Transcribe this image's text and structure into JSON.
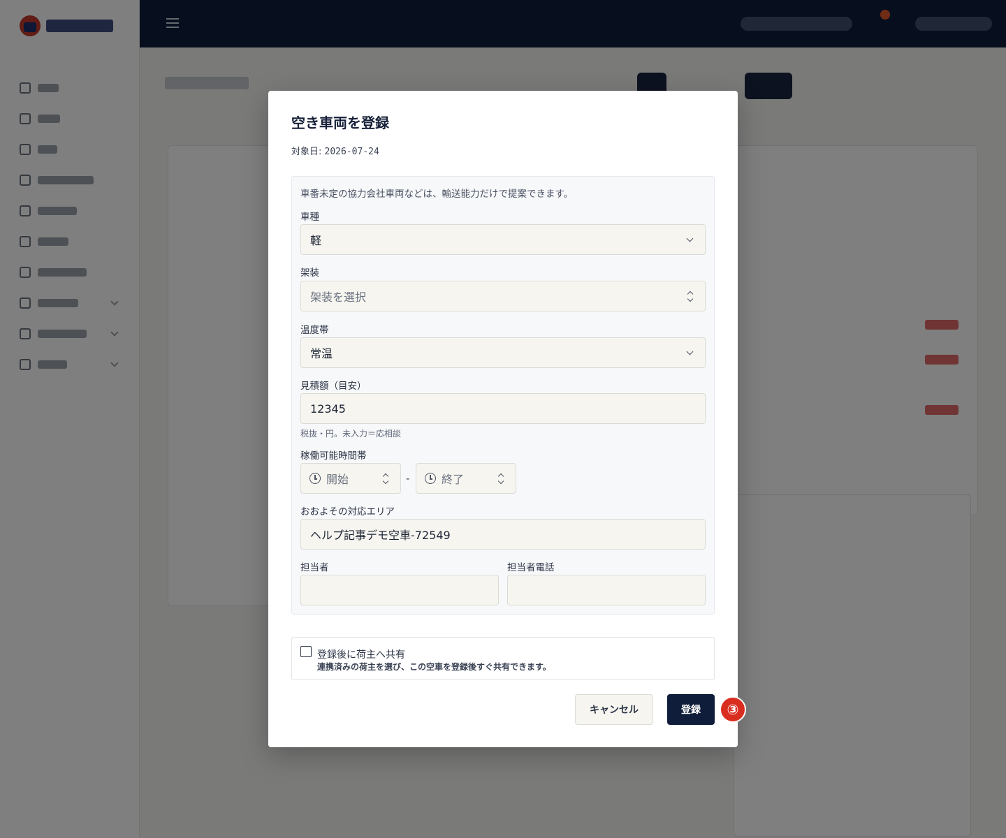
{
  "modal": {
    "title": "空き車両を登録",
    "date_label": "対象日:",
    "date_value": "2026-07-24",
    "hint": "車番未定の協力会社車両などは、輸送能力だけで提案できます。",
    "vehicle_type": {
      "label": "車種",
      "value": "軽"
    },
    "body_type": {
      "label": "架装",
      "placeholder": "架装を選択"
    },
    "temperature": {
      "label": "温度帯",
      "value": "常温"
    },
    "estimate": {
      "label": "見積額（目安）",
      "value": "12345",
      "help": "税抜・円。未入力＝応相談"
    },
    "hours": {
      "label": "稼働可能時間帯",
      "start_placeholder": "開始",
      "separator": "-",
      "end_placeholder": "終了"
    },
    "area": {
      "label": "おおよその対応エリア",
      "value": "ヘルプ記事デモ空車-72549"
    },
    "contact_person": {
      "label": "担当者",
      "value": ""
    },
    "contact_phone": {
      "label": "担当者電話",
      "value": ""
    },
    "share": {
      "label": "登録後に荷主へ共有",
      "description": "連携済みの荷主を選び、この空車を登録後すぐ共有できます。",
      "checked": false
    },
    "cancel_label": "キャンセル",
    "submit_label": "登録"
  },
  "annotation": {
    "step_marker": "③",
    "color": "#d92d20"
  },
  "colors": {
    "navy": "#0f1d3a",
    "field_bg": "#f6f5f0",
    "panel_bg": "#f7f8fa"
  }
}
